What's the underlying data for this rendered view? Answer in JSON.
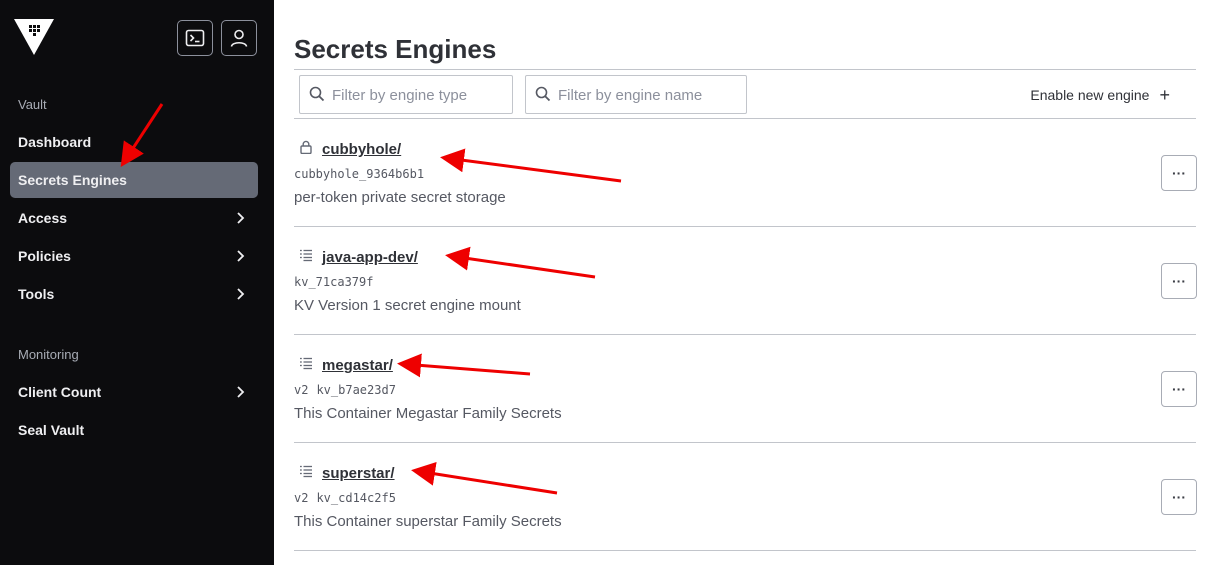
{
  "sidebar": {
    "section_vault": "Vault",
    "section_monitoring": "Monitoring",
    "items": [
      {
        "label": "Dashboard"
      },
      {
        "label": "Secrets Engines"
      },
      {
        "label": "Access"
      },
      {
        "label": "Policies"
      },
      {
        "label": "Tools"
      },
      {
        "label": "Client Count"
      },
      {
        "label": "Seal Vault"
      }
    ],
    "header_icons": [
      "vault-logo-icon",
      "console-icon",
      "user-icon"
    ]
  },
  "main": {
    "title": "Secrets Engines",
    "filter_type_placeholder": "Filter by engine type",
    "filter_name_placeholder": "Filter by engine name",
    "enable_label": "Enable new engine",
    "enable_icon": "+",
    "more_label": "···",
    "engines": [
      {
        "name": "cubbyhole/",
        "version": "",
        "accessor": "cubbyhole_9364b6b1",
        "description": "per-token private secret storage",
        "icon": "lock-icon"
      },
      {
        "name": "java-app-dev/",
        "version": "",
        "accessor": "kv_71ca379f",
        "description": "KV Version 1 secret engine mount",
        "icon": "list-icon"
      },
      {
        "name": "megastar/",
        "version": "v2",
        "accessor": "kv_b7ae23d7",
        "description": "This Container Megastar Family Secrets",
        "icon": "list-icon"
      },
      {
        "name": "superstar/",
        "version": "v2",
        "accessor": "kv_cd14c2f5",
        "description": "This Container superstar Family Secrets",
        "icon": "list-icon"
      }
    ]
  },
  "colors": {
    "sidebar_bg": "#0c0c0e",
    "active_item_bg": "#656a76",
    "annotation_arrow": "#ee0000"
  }
}
